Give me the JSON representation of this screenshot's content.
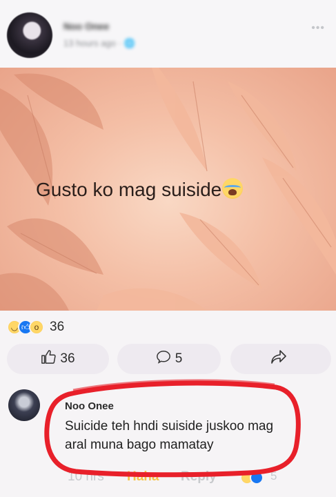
{
  "post": {
    "author": "Noo Onee",
    "meta": "13 hours ago · 🌐",
    "more_icon": "ellipsis-icon",
    "text": "Gusto ko mag suiside",
    "text_emoji": "crying-face-emoji",
    "reactions": {
      "icons": [
        "sad-reaction-icon",
        "like-reaction-icon",
        "wow-reaction-icon"
      ],
      "count": "36"
    },
    "actions": {
      "like_count": "36",
      "comment_count": "5",
      "share_icon": "share-icon"
    }
  },
  "comment": {
    "name": "Noo Onee",
    "text": "Suicide teh hndi suiside juskoo mag aral muna bago mamatay",
    "time": "10 hrs",
    "haha_label": "Haha",
    "reply_label": "Reply",
    "reaction_count": "5"
  },
  "colors": {
    "highlight": "#e8202a",
    "like_blue": "#1877f2",
    "haha_yellow": "#f7c44a"
  }
}
